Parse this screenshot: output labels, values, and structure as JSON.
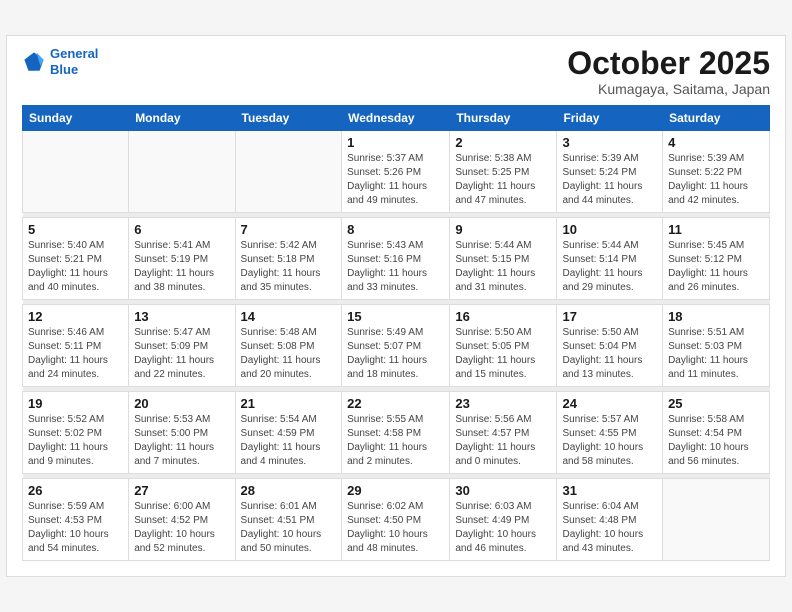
{
  "header": {
    "logo_line1": "General",
    "logo_line2": "Blue",
    "month": "October 2025",
    "location": "Kumagaya, Saitama, Japan"
  },
  "weekdays": [
    "Sunday",
    "Monday",
    "Tuesday",
    "Wednesday",
    "Thursday",
    "Friday",
    "Saturday"
  ],
  "weeks": [
    [
      {
        "day": "",
        "info": ""
      },
      {
        "day": "",
        "info": ""
      },
      {
        "day": "",
        "info": ""
      },
      {
        "day": "1",
        "info": "Sunrise: 5:37 AM\nSunset: 5:26 PM\nDaylight: 11 hours\nand 49 minutes."
      },
      {
        "day": "2",
        "info": "Sunrise: 5:38 AM\nSunset: 5:25 PM\nDaylight: 11 hours\nand 47 minutes."
      },
      {
        "day": "3",
        "info": "Sunrise: 5:39 AM\nSunset: 5:24 PM\nDaylight: 11 hours\nand 44 minutes."
      },
      {
        "day": "4",
        "info": "Sunrise: 5:39 AM\nSunset: 5:22 PM\nDaylight: 11 hours\nand 42 minutes."
      }
    ],
    [
      {
        "day": "5",
        "info": "Sunrise: 5:40 AM\nSunset: 5:21 PM\nDaylight: 11 hours\nand 40 minutes."
      },
      {
        "day": "6",
        "info": "Sunrise: 5:41 AM\nSunset: 5:19 PM\nDaylight: 11 hours\nand 38 minutes."
      },
      {
        "day": "7",
        "info": "Sunrise: 5:42 AM\nSunset: 5:18 PM\nDaylight: 11 hours\nand 35 minutes."
      },
      {
        "day": "8",
        "info": "Sunrise: 5:43 AM\nSunset: 5:16 PM\nDaylight: 11 hours\nand 33 minutes."
      },
      {
        "day": "9",
        "info": "Sunrise: 5:44 AM\nSunset: 5:15 PM\nDaylight: 11 hours\nand 31 minutes."
      },
      {
        "day": "10",
        "info": "Sunrise: 5:44 AM\nSunset: 5:14 PM\nDaylight: 11 hours\nand 29 minutes."
      },
      {
        "day": "11",
        "info": "Sunrise: 5:45 AM\nSunset: 5:12 PM\nDaylight: 11 hours\nand 26 minutes."
      }
    ],
    [
      {
        "day": "12",
        "info": "Sunrise: 5:46 AM\nSunset: 5:11 PM\nDaylight: 11 hours\nand 24 minutes."
      },
      {
        "day": "13",
        "info": "Sunrise: 5:47 AM\nSunset: 5:09 PM\nDaylight: 11 hours\nand 22 minutes."
      },
      {
        "day": "14",
        "info": "Sunrise: 5:48 AM\nSunset: 5:08 PM\nDaylight: 11 hours\nand 20 minutes."
      },
      {
        "day": "15",
        "info": "Sunrise: 5:49 AM\nSunset: 5:07 PM\nDaylight: 11 hours\nand 18 minutes."
      },
      {
        "day": "16",
        "info": "Sunrise: 5:50 AM\nSunset: 5:05 PM\nDaylight: 11 hours\nand 15 minutes."
      },
      {
        "day": "17",
        "info": "Sunrise: 5:50 AM\nSunset: 5:04 PM\nDaylight: 11 hours\nand 13 minutes."
      },
      {
        "day": "18",
        "info": "Sunrise: 5:51 AM\nSunset: 5:03 PM\nDaylight: 11 hours\nand 11 minutes."
      }
    ],
    [
      {
        "day": "19",
        "info": "Sunrise: 5:52 AM\nSunset: 5:02 PM\nDaylight: 11 hours\nand 9 minutes."
      },
      {
        "day": "20",
        "info": "Sunrise: 5:53 AM\nSunset: 5:00 PM\nDaylight: 11 hours\nand 7 minutes."
      },
      {
        "day": "21",
        "info": "Sunrise: 5:54 AM\nSunset: 4:59 PM\nDaylight: 11 hours\nand 4 minutes."
      },
      {
        "day": "22",
        "info": "Sunrise: 5:55 AM\nSunset: 4:58 PM\nDaylight: 11 hours\nand 2 minutes."
      },
      {
        "day": "23",
        "info": "Sunrise: 5:56 AM\nSunset: 4:57 PM\nDaylight: 11 hours\nand 0 minutes."
      },
      {
        "day": "24",
        "info": "Sunrise: 5:57 AM\nSunset: 4:55 PM\nDaylight: 10 hours\nand 58 minutes."
      },
      {
        "day": "25",
        "info": "Sunrise: 5:58 AM\nSunset: 4:54 PM\nDaylight: 10 hours\nand 56 minutes."
      }
    ],
    [
      {
        "day": "26",
        "info": "Sunrise: 5:59 AM\nSunset: 4:53 PM\nDaylight: 10 hours\nand 54 minutes."
      },
      {
        "day": "27",
        "info": "Sunrise: 6:00 AM\nSunset: 4:52 PM\nDaylight: 10 hours\nand 52 minutes."
      },
      {
        "day": "28",
        "info": "Sunrise: 6:01 AM\nSunset: 4:51 PM\nDaylight: 10 hours\nand 50 minutes."
      },
      {
        "day": "29",
        "info": "Sunrise: 6:02 AM\nSunset: 4:50 PM\nDaylight: 10 hours\nand 48 minutes."
      },
      {
        "day": "30",
        "info": "Sunrise: 6:03 AM\nSunset: 4:49 PM\nDaylight: 10 hours\nand 46 minutes."
      },
      {
        "day": "31",
        "info": "Sunrise: 6:04 AM\nSunset: 4:48 PM\nDaylight: 10 hours\nand 43 minutes."
      },
      {
        "day": "",
        "info": ""
      }
    ]
  ]
}
